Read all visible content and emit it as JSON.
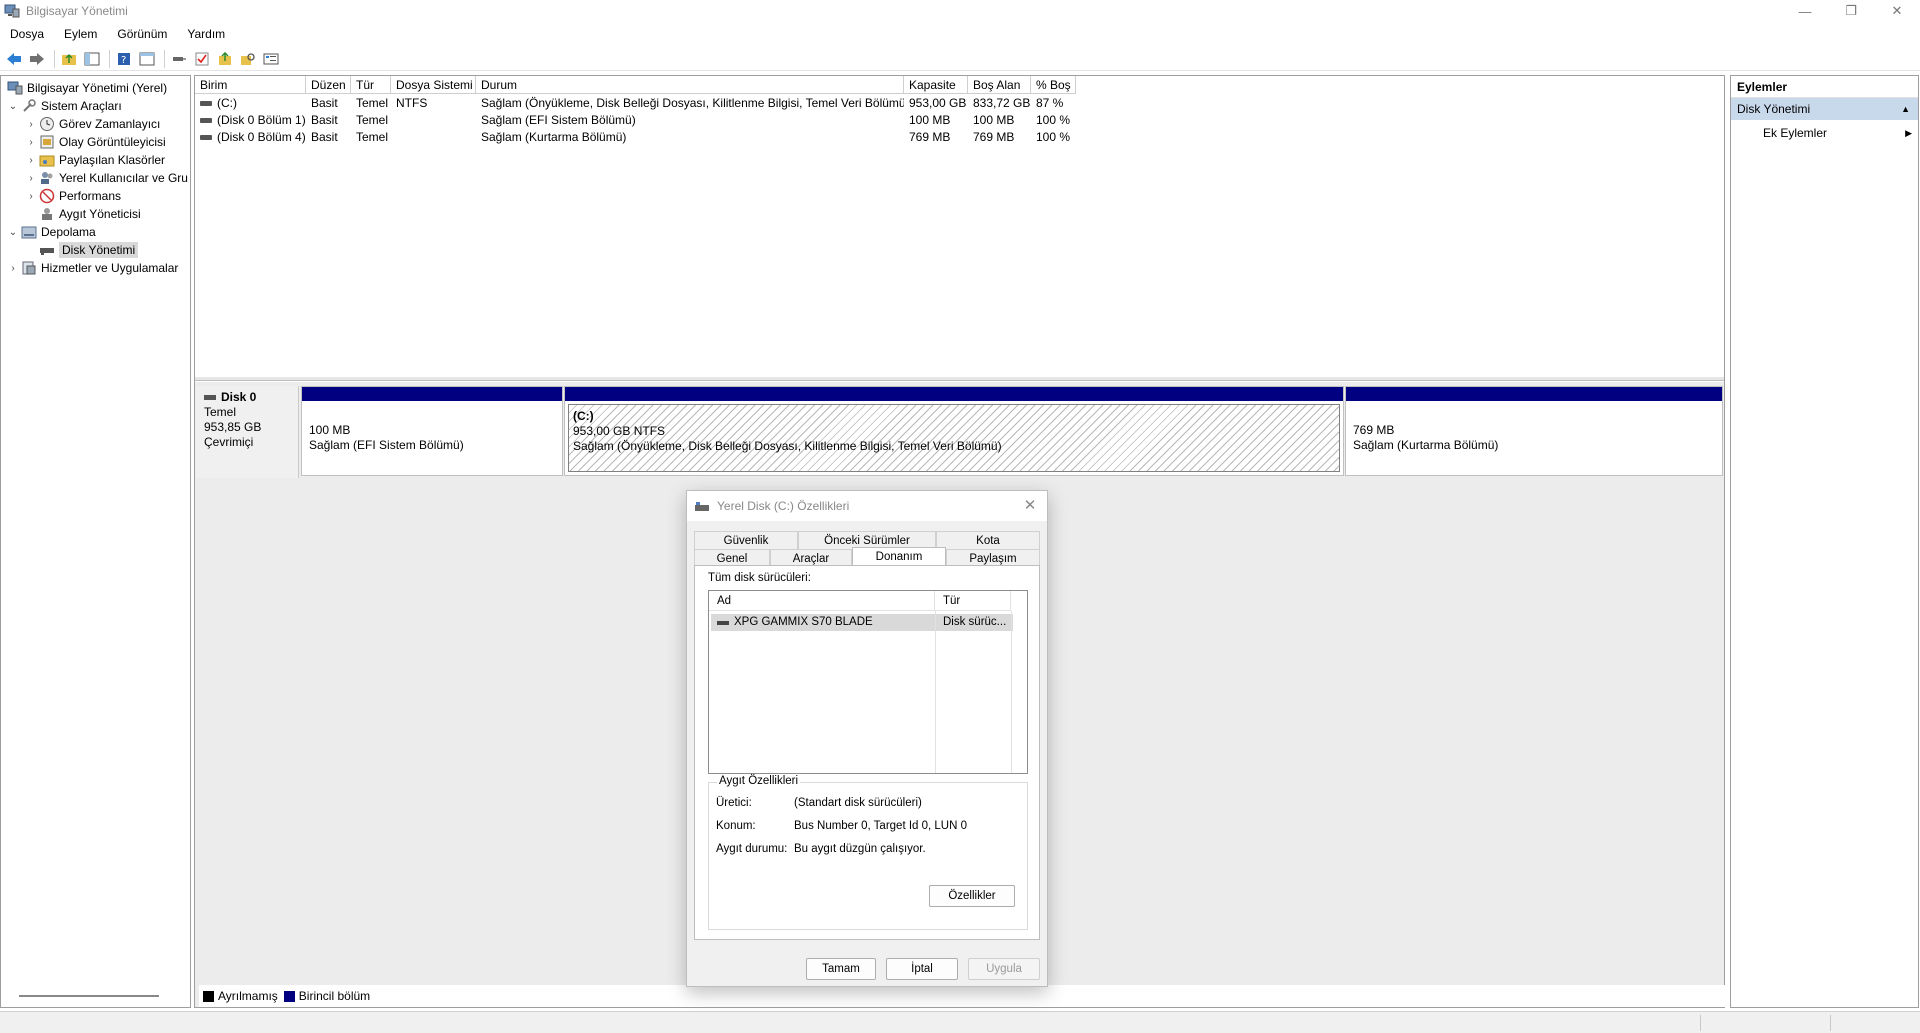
{
  "window": {
    "title": "Bilgisayar Yönetimi",
    "controls": {
      "minimize": "—",
      "restore": "❐",
      "close": "✕"
    }
  },
  "menu": [
    "Dosya",
    "Eylem",
    "Görünüm",
    "Yardım"
  ],
  "tree": {
    "root": "Bilgisayar Yönetimi (Yerel)",
    "sistem_araclari": "Sistem Araçları",
    "gorev_zamanlayici": "Görev Zamanlayıcı",
    "olay_goruntuleyici": "Olay Görüntüleyicisi",
    "paylasilan_klasorler": "Paylaşılan Klasörler",
    "yerel_kullanicilar": "Yerel Kullanıcılar ve Gru",
    "performans": "Performans",
    "aygit_yoneticisi": "Aygıt Yöneticisi",
    "depolama": "Depolama",
    "disk_yonetimi": "Disk Yönetimi",
    "hizmetler": "Hizmetler ve Uygulamalar"
  },
  "volumes": {
    "headers": [
      "Birim",
      "Düzen",
      "Tür",
      "Dosya Sistemi",
      "Durum",
      "Kapasite",
      "Boş Alan",
      "% Boş"
    ],
    "rows": [
      [
        "(C:)",
        "Basit",
        "Temel",
        "NTFS",
        "Sağlam (Önyükleme, Disk Belleği Dosyası, Kilitlenme Bilgisi, Temel Veri Bölümü)",
        "953,00 GB",
        "833,72 GB",
        "87 %"
      ],
      [
        "(Disk 0 Bölüm 1)",
        "Basit",
        "Temel",
        "",
        "Sağlam (EFI Sistem Bölümü)",
        "100 MB",
        "100 MB",
        "100 %"
      ],
      [
        "(Disk 0 Bölüm 4)",
        "Basit",
        "Temel",
        "",
        "Sağlam (Kurtarma Bölümü)",
        "769 MB",
        "769 MB",
        "100 %"
      ]
    ]
  },
  "disk": {
    "name": "Disk 0",
    "type": "Temel",
    "size": "953,85 GB",
    "status": "Çevrimiçi",
    "partitions": [
      {
        "line1": "",
        "line2": "100 MB",
        "line3": "Sağlam (EFI Sistem Bölümü)"
      },
      {
        "line1": "(C:)",
        "line2": "953,00 GB NTFS",
        "line3": "Sağlam (Önyükleme, Disk Belleği Dosyası, Kilitlenme Bilgisi, Temel Veri Bölümü)"
      },
      {
        "line1": "",
        "line2": "769 MB",
        "line3": "Sağlam (Kurtarma Bölümü)"
      }
    ]
  },
  "legend": {
    "unallocated": "Ayrılmamış",
    "primary": "Birincil bölüm",
    "unallocated_color": "#000000",
    "primary_color": "#000080"
  },
  "actions": {
    "header": "Eylemler",
    "section": "Disk Yönetimi",
    "more": "Ek Eylemler"
  },
  "dialog": {
    "title": "Yerel Disk (C:) Özellikleri",
    "tabs_top": [
      "Güvenlik",
      "Önceki Sürümler",
      "Kota"
    ],
    "tabs_bottom": [
      "Genel",
      "Araçlar",
      "Donanım",
      "Paylaşım"
    ],
    "all_drives_label": "Tüm disk sürücüleri:",
    "list_headers": [
      "Ad",
      "Tür"
    ],
    "list_row": {
      "name": "XPG GAMMIX S70 BLADE",
      "type": "Disk sürüc..."
    },
    "group_title": "Aygıt Özellikleri",
    "props": [
      {
        "k": "Üretici:",
        "v": "(Standart disk sürücüleri)"
      },
      {
        "k": "Konum:",
        "v": "Bus Number 0, Target Id 0, LUN 0"
      },
      {
        "k": "Aygıt durumu:",
        "v": "Bu aygıt düzgün çalışıyor."
      }
    ],
    "properties_button": "Özellikler",
    "ok": "Tamam",
    "cancel": "İptal",
    "apply": "Uygula"
  }
}
